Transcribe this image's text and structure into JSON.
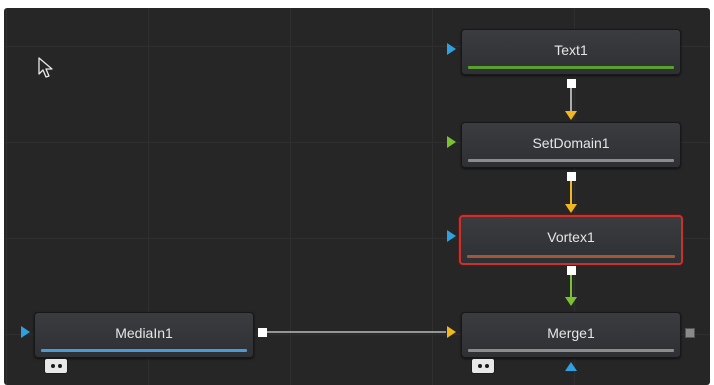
{
  "nodes": {
    "text1": {
      "label": "Text1",
      "bar_color": "#5aa02c",
      "input_color": "#2fa0e0"
    },
    "setdomain1": {
      "label": "SetDomain1",
      "bar_color": "#8c8c8c",
      "input_color": "#7ac232"
    },
    "vortex1": {
      "label": "Vortex1",
      "bar_color": "#a0583a",
      "input_color": "#2fa0e0",
      "selected": true
    },
    "mediain1": {
      "label": "MediaIn1",
      "bar_color": "#4a9ad8",
      "input_color": "#2fa0e0"
    },
    "merge1": {
      "label": "Merge1",
      "bar_color": "#8c8c8c",
      "input_color": "#f0b81e",
      "mask_input_color": "#2fa0e0"
    }
  },
  "connections": [
    {
      "from": "Text1",
      "to": "SetDomain1",
      "color": "#f0b81e"
    },
    {
      "from": "SetDomain1",
      "to": "Vortex1",
      "color": "#f0b81e"
    },
    {
      "from": "Vortex1",
      "to": "Merge1",
      "color": "#7ac232"
    },
    {
      "from": "MediaIn1",
      "to": "Merge1",
      "color": "#f0b81e"
    }
  ],
  "colors": {
    "canvas": "#262626",
    "selection_border": "#c8322c",
    "wire": "#d8d8d8"
  }
}
